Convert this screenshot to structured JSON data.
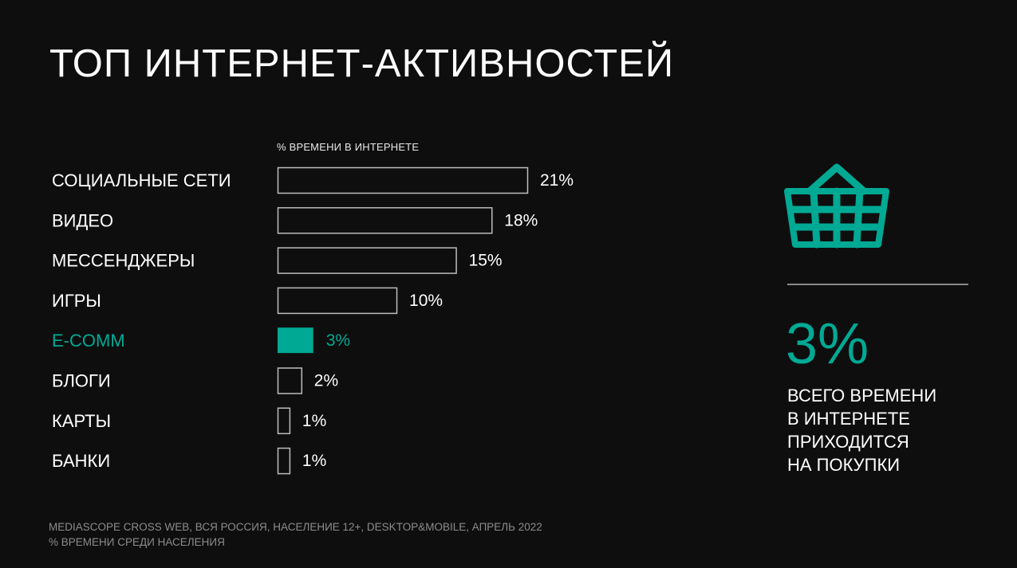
{
  "title": "ТОП ИНТЕРНЕТ-АКТИВНОСТЕЙ",
  "colors": {
    "background": "#0e0e0e",
    "accent": "#00a994",
    "bar_outline": "#bdbdbd",
    "text": "#ffffff",
    "muted": "#8c8c8c"
  },
  "chart_data": {
    "type": "bar",
    "orientation": "horizontal",
    "title": "ТОП ИНТЕРНЕТ-АКТИВНОСТЕЙ",
    "xlabel": "% ВРЕМЕНИ В ИНТЕРНЕТЕ",
    "ylabel": "",
    "categories": [
      "СОЦИАЛЬНЫЕ СЕТИ",
      "ВИДЕО",
      "МЕССЕНДЖЕРЫ",
      "ИГРЫ",
      "E-COMM",
      "БЛОГИ",
      "КАРТЫ",
      "БАНКИ"
    ],
    "values": [
      21,
      18,
      15,
      10,
      3,
      2,
      1,
      1
    ],
    "value_labels": [
      "21%",
      "18%",
      "15%",
      "10%",
      "3%",
      "2%",
      "1%",
      "1%"
    ],
    "highlight_category": "E-COMM",
    "unit": "%",
    "xlim": [
      0,
      21
    ],
    "grid": false,
    "legend": "none"
  },
  "side_panel": {
    "icon": "shopping-basket-icon",
    "big_value": "3%",
    "caption_lines": [
      "ВСЕГО ВРЕМЕНИ",
      "В ИНТЕРНЕТЕ",
      "ПРИХОДИТСЯ",
      "НА ПОКУПКИ"
    ]
  },
  "footnote": {
    "lines": [
      "MEDIASCOPE CROSS WEB, ВСЯ РОССИЯ, НАСЕЛЕНИЕ 12+, DESKTOP&MOBILE, АПРЕЛЬ 2022",
      "% ВРЕМЕНИ СРЕДИ НАСЕЛЕНИЯ"
    ]
  }
}
